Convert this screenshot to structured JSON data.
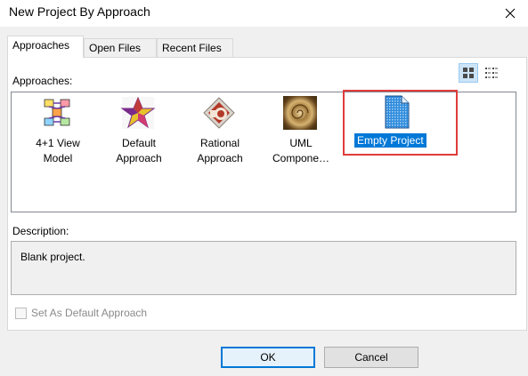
{
  "window": {
    "title": "New Project By Approach"
  },
  "tabs": [
    {
      "label": "Approaches",
      "active": true
    },
    {
      "label": "Open Files",
      "active": false
    },
    {
      "label": "Recent Files",
      "active": false
    }
  ],
  "approaches_label": "Approaches:",
  "view_toggle": {
    "selected": "large-icons"
  },
  "approaches": [
    {
      "line1": "4+1 View",
      "line2": "Model",
      "icon": "4plus1-view-icon"
    },
    {
      "line1": "Default",
      "line2": "Approach",
      "icon": "default-approach-star-icon"
    },
    {
      "line1": "Rational",
      "line2": "Approach",
      "icon": "rational-approach-icon"
    },
    {
      "line1": "UML",
      "line2": "Compone…",
      "icon": "uml-component-icon"
    },
    {
      "line1": "Empty Project",
      "line2": "",
      "icon": "empty-project-document-icon",
      "selected": true
    }
  ],
  "description_label": "Description:",
  "description_text": "Blank project.",
  "default_checkbox": {
    "label": "Set As Default Approach",
    "checked": false,
    "enabled": false
  },
  "buttons": {
    "ok": "OK",
    "cancel": "Cancel"
  },
  "colors": {
    "selection": "#0078d7",
    "highlight_frame": "#e03b3b"
  }
}
